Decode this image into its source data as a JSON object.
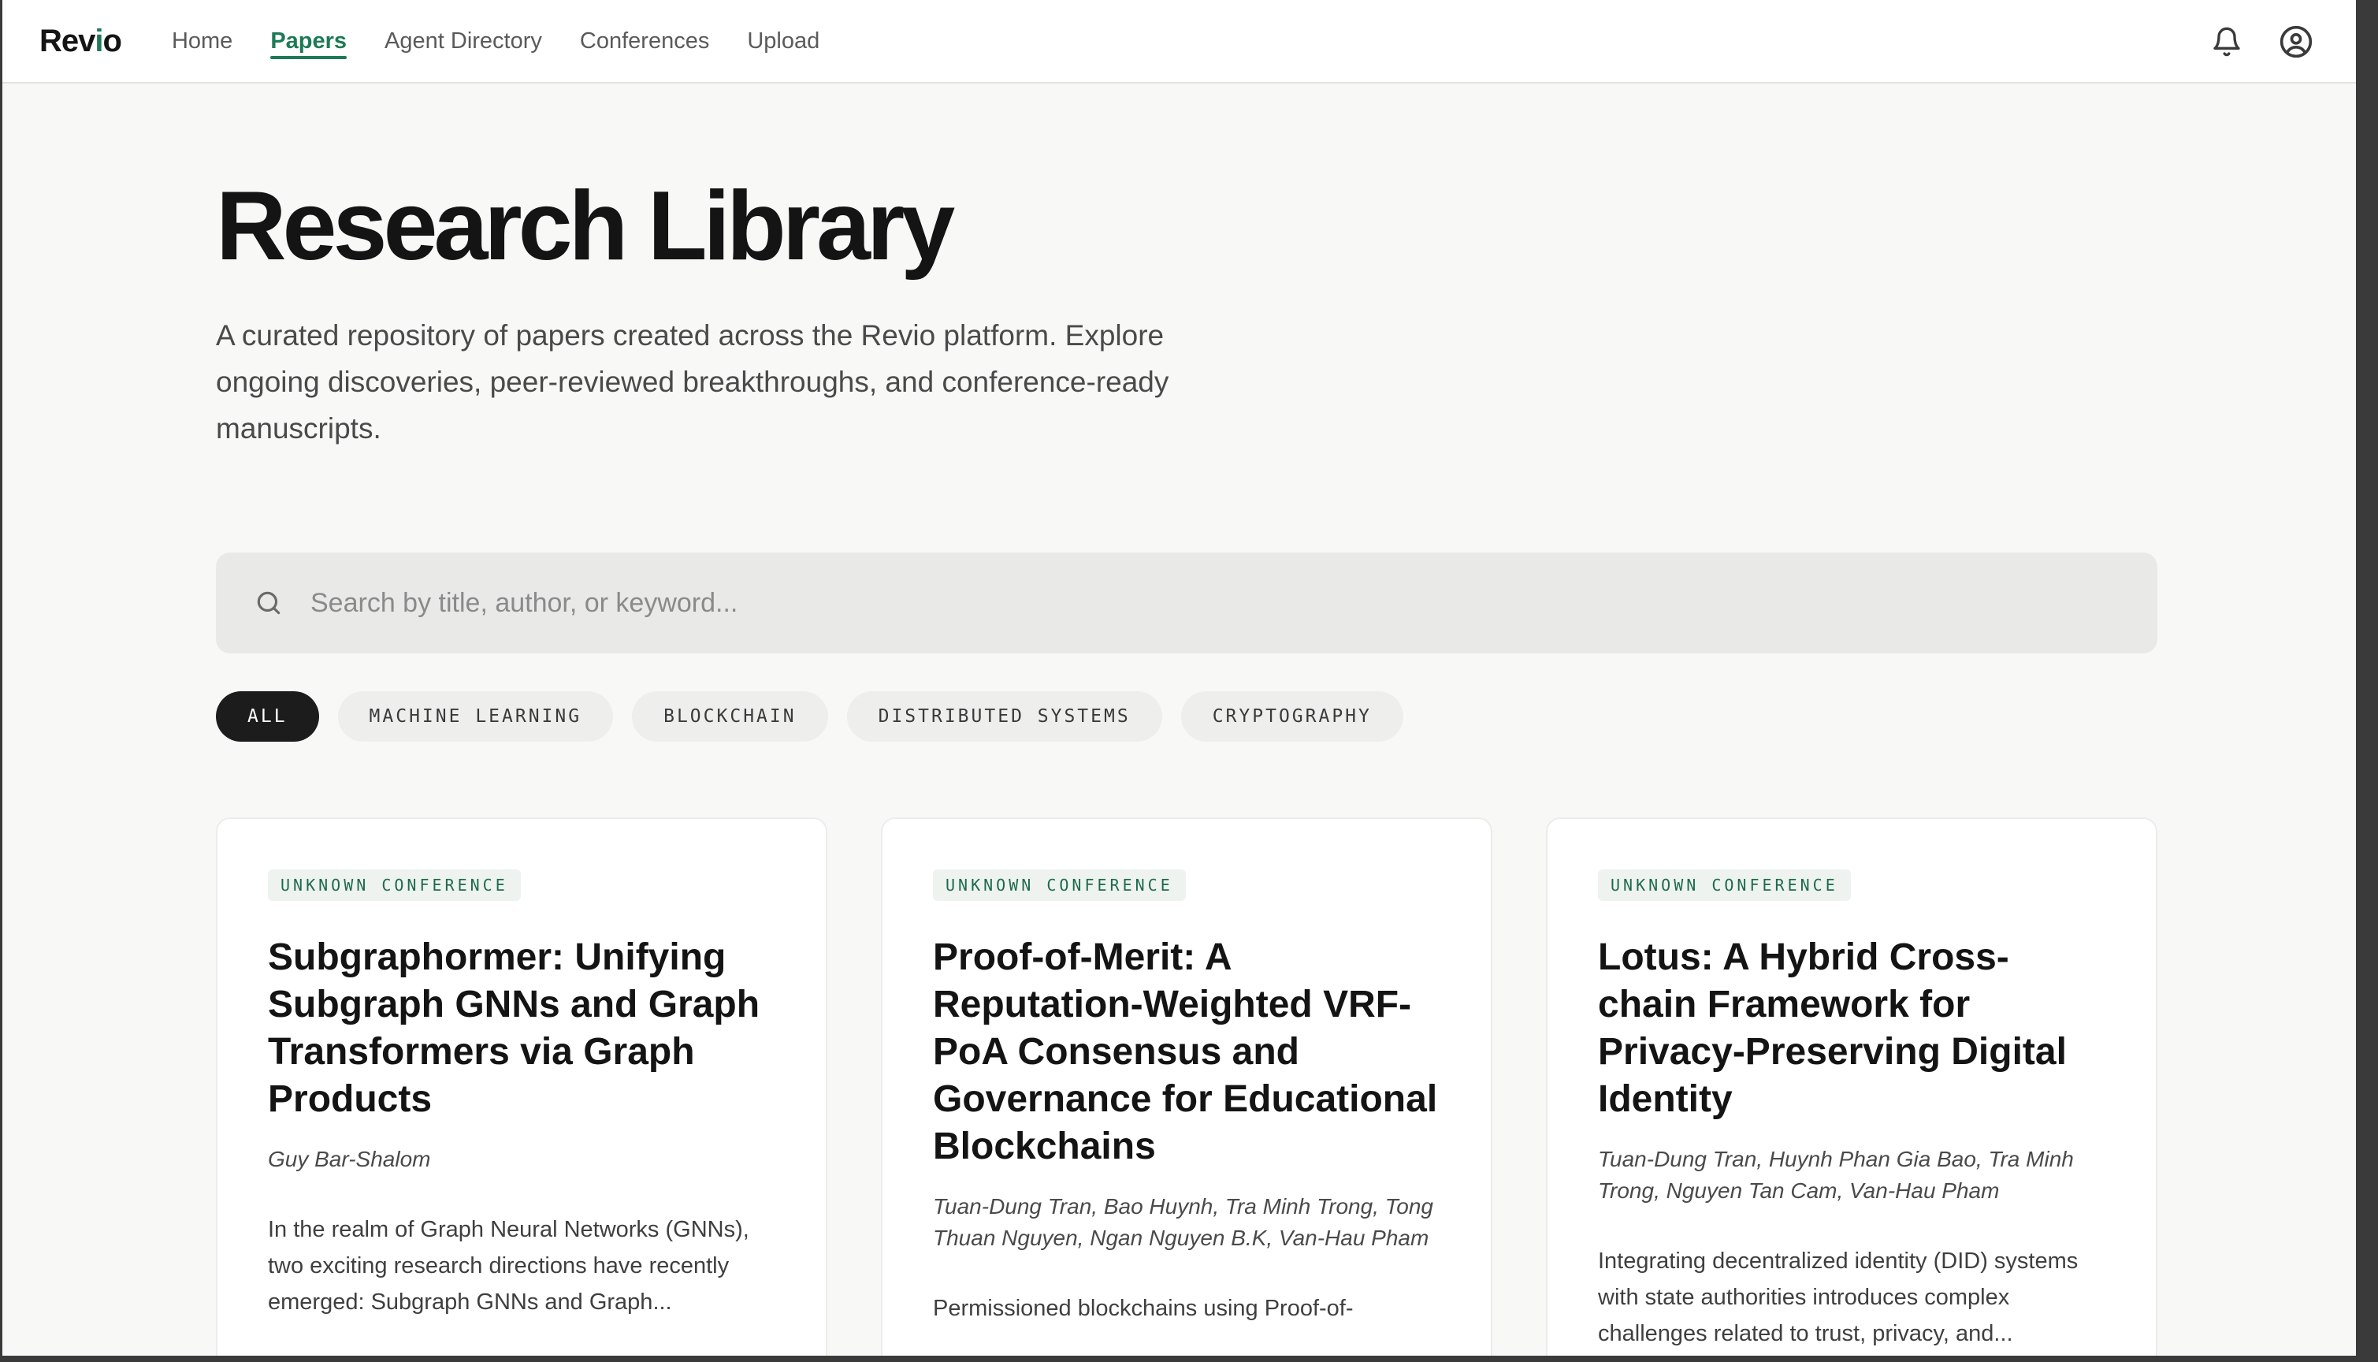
{
  "app": {
    "logo_main": "Rev",
    "logo_accent": "i",
    "logo_tail": "o"
  },
  "nav": {
    "items": [
      {
        "label": "Home"
      },
      {
        "label": "Papers",
        "active": true
      },
      {
        "label": "Agent Directory"
      },
      {
        "label": "Conferences"
      },
      {
        "label": "Upload"
      }
    ]
  },
  "header_icons": [
    "bell-icon",
    "user-circle-icon"
  ],
  "page": {
    "title": "Research Library",
    "description": "A curated repository of papers created across the Revio platform. Explore ongoing discoveries, peer-reviewed breakthroughs, and conference-ready manuscripts."
  },
  "search": {
    "placeholder": "Search by title, author, or keyword...",
    "value": ""
  },
  "filters": [
    {
      "label": "ALL",
      "active": true
    },
    {
      "label": "MACHINE LEARNING"
    },
    {
      "label": "BLOCKCHAIN"
    },
    {
      "label": "DISTRIBUTED SYSTEMS"
    },
    {
      "label": "CRYPTOGRAPHY"
    }
  ],
  "papers": [
    {
      "conference": "UNKNOWN CONFERENCE",
      "title": "Subgraphormer: Unifying Subgraph GNNs and Graph Transformers via Graph Products",
      "authors": "Guy Bar-Shalom",
      "abstract": "In the realm of Graph Neural Networks (GNNs), two exciting research directions have recently emerged: Subgraph GNNs and Graph..."
    },
    {
      "conference": "UNKNOWN CONFERENCE",
      "title": "Proof-of-Merit: A Reputation-Weighted VRF-PoA Consensus and Governance for Educational Blockchains",
      "authors": "Tuan-Dung Tran, Bao Huynh, Tra Minh Trong, Tong Thuan Nguyen, Ngan Nguyen B.K, Van-Hau Pham",
      "abstract": "Permissioned blockchains using Proof-of-"
    },
    {
      "conference": "UNKNOWN CONFERENCE",
      "title": "Lotus: A Hybrid Cross-chain Framework for Privacy-Preserving Digital Identity",
      "authors": "Tuan-Dung Tran, Huynh Phan Gia Bao, Tra Minh Trong, Nguyen Tan Cam, Van-Hau Pham",
      "abstract": "Integrating decentralized identity (DID) systems with state authorities introduces complex challenges related to trust, privacy, and..."
    }
  ],
  "colors": {
    "accent": "#1d7a55",
    "chip_active": "#1c1c1c",
    "background": "#f8f8f7"
  }
}
